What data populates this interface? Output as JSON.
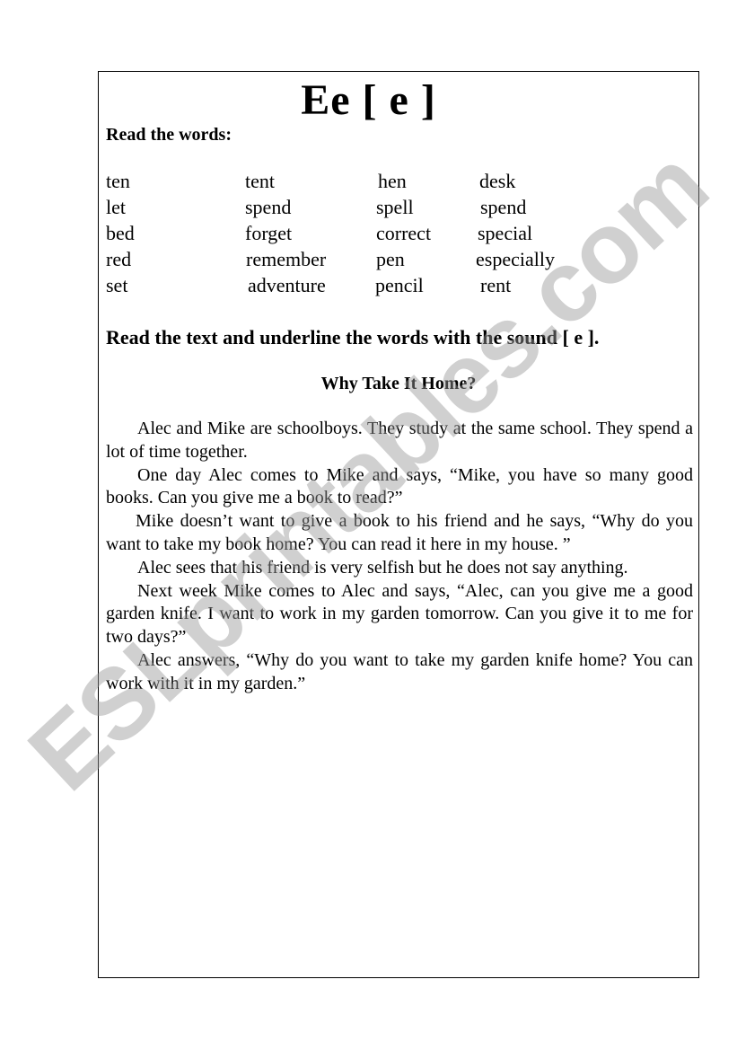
{
  "worksheet": {
    "title": "Ee [ e ]",
    "section1_heading": "Read the words:",
    "word_columns": [
      [
        "ten",
        "let",
        "bed",
        "red",
        "set"
      ],
      [
        "tent",
        "spend",
        "forget",
        "remember",
        "adventure"
      ],
      [
        "hen",
        "spell",
        "correct",
        "pen",
        "pencil"
      ],
      [
        "desk",
        "spend",
        "special",
        "especially",
        "rent"
      ]
    ],
    "section2_heading": "Read the text and underline the words with the sound [ e ].",
    "story_title": "Why Take It Home?",
    "story_paragraphs": [
      "Alec and Mike are schoolboys. They study at the same school. They spend a lot of time together.",
      "One day Alec comes to Mike and says, “Mike, you have so many good books. Can you give me a book to read?”",
      "Mike doesn’t want to give a book to his friend and he says, “Why do you want to take my book home? You can read it here in my house. ”",
      "Alec sees that his friend is very selfish but he does not say anything.",
      "Next week Mike comes to Alec and says, “Alec, can you give me a good garden knife.  I want to work in my garden tomorrow. Can you give it to me for two days?”",
      "Alec answers, “Why do you want to take my garden knife home? You can work with it in my garden.”"
    ]
  },
  "watermark": {
    "text": "ESLprintables.com"
  }
}
